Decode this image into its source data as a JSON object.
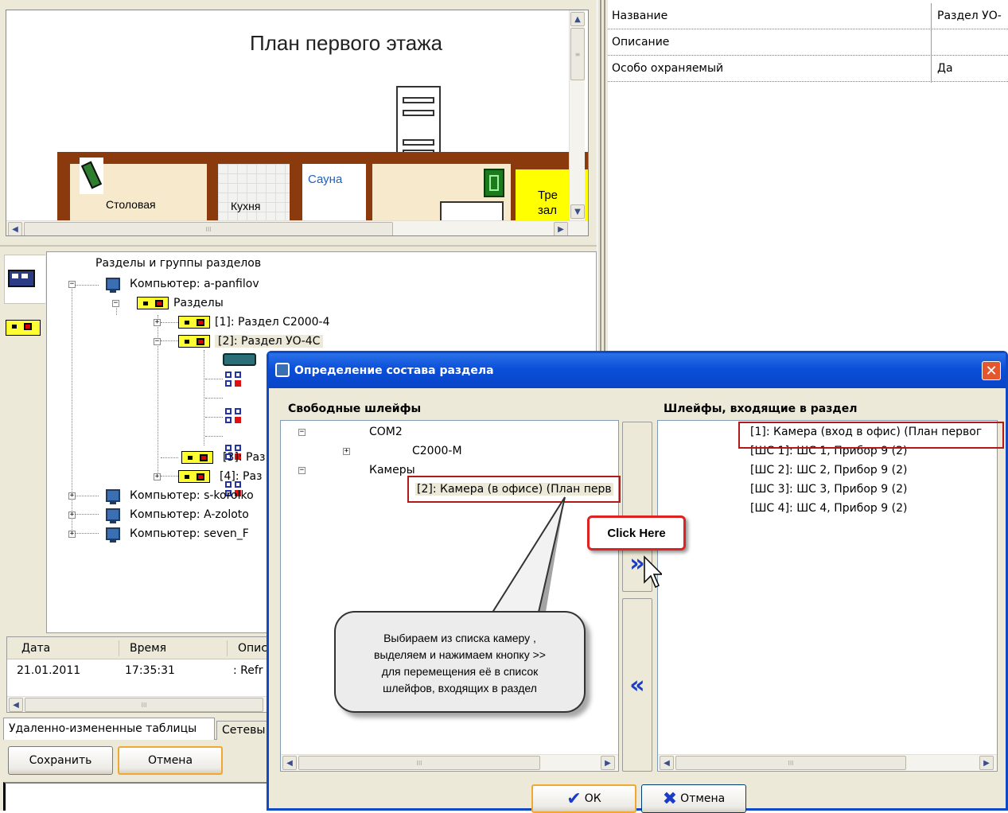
{
  "floorplan": {
    "title": "План первого этажа",
    "rooms": {
      "dining": "Столовая",
      "kitchen": "Кухня",
      "sauna": "Сауна",
      "gym_1": "Тре",
      "gym_2": "зал"
    }
  },
  "properties": [
    {
      "name": "Название",
      "value": "Раздел УО-"
    },
    {
      "name": "Описание",
      "value": ""
    },
    {
      "name": "Особо охраняемый",
      "value": "Да"
    }
  ],
  "tree": {
    "root": "Разделы и группы разделов",
    "computer1": "Компьютер: a-panfilov",
    "partitions": "Разделы",
    "p1": "[1]: Раздел С2000-4",
    "p2": "[2]: Раздел УО-4С",
    "p3": "[3]: Раз",
    "p4": "[4]: Раз",
    "computer2": "Компьютер: s-korolko",
    "computer3": "Компьютер: A-zoloto",
    "computer4": "Компьютер: seven_F"
  },
  "log": {
    "columns": [
      "Дата",
      "Время",
      "Опис"
    ],
    "rows": [
      [
        "21.01.2011",
        "17:35:31",
        ": Refr"
      ]
    ]
  },
  "bottom_tabs": [
    "Удаленно-измененные таблицы",
    "Сетевы"
  ],
  "bottom_buttons": {
    "save": "Сохранить",
    "cancel": "Отмена"
  },
  "dialog": {
    "title": "Определение состава раздела",
    "left_header": "Свободные шлейфы",
    "right_header": "Шлейфы, входящие в раздел",
    "left_items": {
      "com2": "COM2",
      "c2000m": "C2000-M",
      "cameras": "Камеры",
      "camera2": "[2]: Камера (в офисе) (План перв"
    },
    "right_items": [
      "[1]: Камера (вход в офис) (План первог",
      "[ШС 1]: ШС 1, Прибор 9 (2)",
      "[ШС 2]: ШС 2, Прибор 9 (2)",
      "[ШС 3]: ШС 3, Прибор 9 (2)",
      "[ШС 4]: ШС 4, Прибор 9 (2)"
    ],
    "move_right": "»",
    "move_left": "«",
    "ok": "ОК",
    "cancel": "Отмена"
  },
  "callouts": {
    "click_here": "Click Here",
    "instruction_1": "Выбираем из списка камеру ,",
    "instruction_2": "выделяем и нажимаем кнопку >>",
    "instruction_3": "для перемещения её в список",
    "instruction_4": "шлейфов, входящих в раздел"
  },
  "colors": {
    "titlebar": "#0a4fd8",
    "highlight": "#b11a1a",
    "partition_yellow": "#ffff33",
    "floor_brown": "#8b3a0e"
  }
}
